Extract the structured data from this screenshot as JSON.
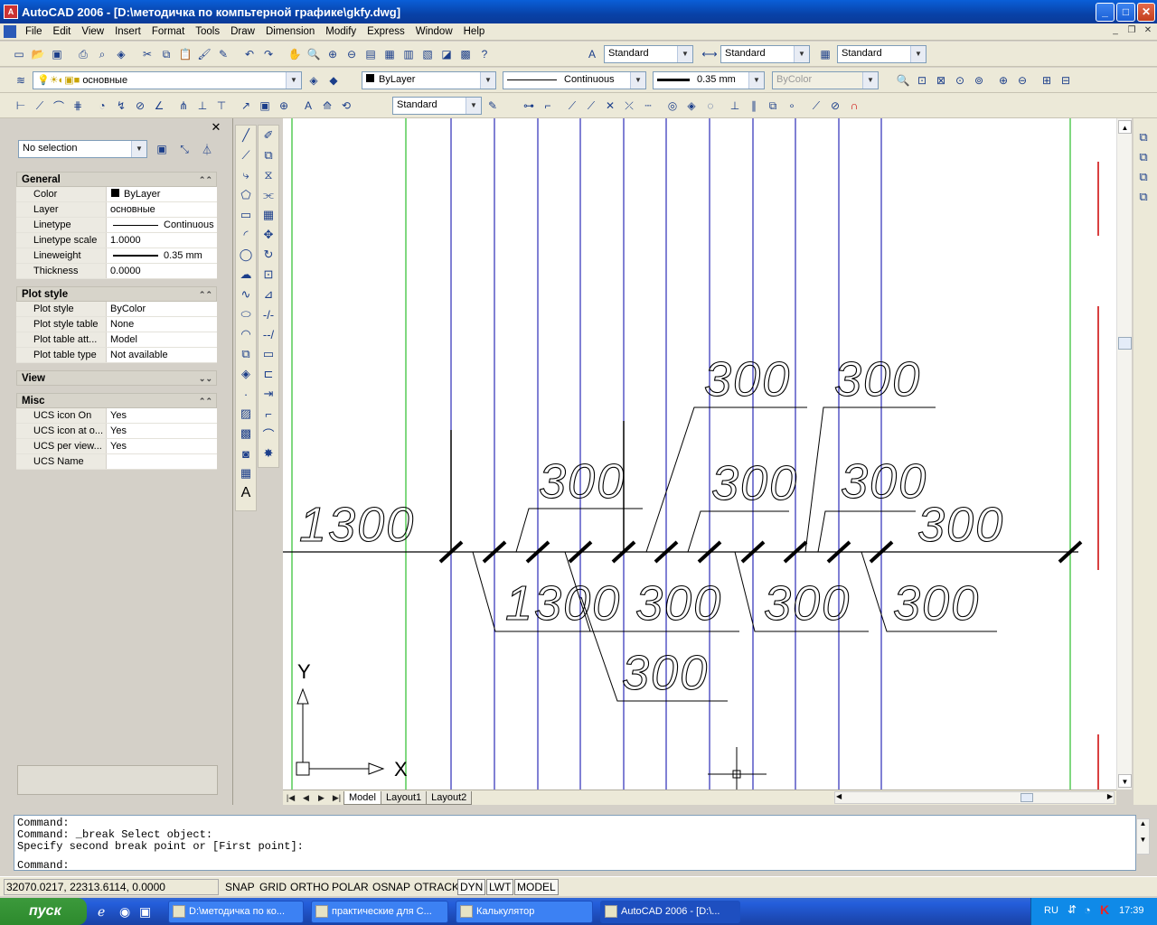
{
  "window": {
    "title": "AutoCAD 2006 - [D:\\методичка по компьтерной графике\\gkfy.dwg]",
    "app_icon_text": "A"
  },
  "menu": [
    "File",
    "Edit",
    "View",
    "Insert",
    "Format",
    "Tools",
    "Draw",
    "Dimension",
    "Modify",
    "Express",
    "Window",
    "Help"
  ],
  "styles_toolbar": {
    "text_style": "Standard",
    "dim_style": "Standard",
    "table_style": "Standard"
  },
  "layers_toolbar": {
    "layer": "основные"
  },
  "properties_toolbar": {
    "color": "ByLayer",
    "linetype": "Continuous",
    "lineweight": "0.35 mm",
    "plot_style": "ByColor"
  },
  "dim_toolbar": {
    "dim_style": "Standard"
  },
  "palette": {
    "selection": "No selection",
    "sections": [
      {
        "name": "General",
        "rows": [
          {
            "key": "Color",
            "value": "ByLayer"
          },
          {
            "key": "Layer",
            "value": "основные"
          },
          {
            "key": "Linetype",
            "value": "Continuous"
          },
          {
            "key": "Linetype scale",
            "value": "1.0000"
          },
          {
            "key": "Lineweight",
            "value": "0.35 mm"
          },
          {
            "key": "Thickness",
            "value": "0.0000"
          }
        ]
      },
      {
        "name": "Plot style",
        "rows": [
          {
            "key": "Plot style",
            "value": "ByColor"
          },
          {
            "key": "Plot style table",
            "value": "None"
          },
          {
            "key": "Plot table att...",
            "value": "Model"
          },
          {
            "key": "Plot table type",
            "value": "Not available"
          }
        ]
      },
      {
        "name": "View",
        "rows": []
      },
      {
        "name": "Misc",
        "rows": [
          {
            "key": "UCS icon On",
            "value": "Yes"
          },
          {
            "key": "UCS icon at o...",
            "value": "Yes"
          },
          {
            "key": "UCS per view...",
            "value": "Yes"
          },
          {
            "key": "UCS Name",
            "value": ""
          }
        ]
      }
    ]
  },
  "drawing": {
    "dimension_labels": [
      "1300",
      "300",
      "300",
      "300",
      "300",
      "300",
      "300",
      "1300",
      "300",
      "300",
      "300",
      "300",
      "300"
    ],
    "ucs_x": "X",
    "ucs_y": "Y",
    "colors": {
      "green": "#00b000",
      "blue": "#0000aa",
      "red": "#cc0000",
      "black": "#000000"
    }
  },
  "layout_tabs": [
    "Model",
    "Layout1",
    "Layout2"
  ],
  "command_lines": [
    "Command:",
    "Command: _break Select object:",
    "Specify second break point or [First point]:"
  ],
  "command_prompt": "Command:",
  "status": {
    "coords": "32070.0217, 22313.6114, 0.0000",
    "toggles": [
      "SNAP",
      "GRID",
      "ORTHO",
      "POLAR",
      "OSNAP",
      "OTRACK",
      "DYN",
      "LWT",
      "MODEL"
    ]
  },
  "taskbar": {
    "start": "пуск",
    "tasks": [
      "D:\\методичка по ко...",
      "практические для С...",
      "Калькулятор",
      "AutoCAD 2006 - [D:\\..."
    ],
    "lang": "RU",
    "clock": "17:39"
  }
}
